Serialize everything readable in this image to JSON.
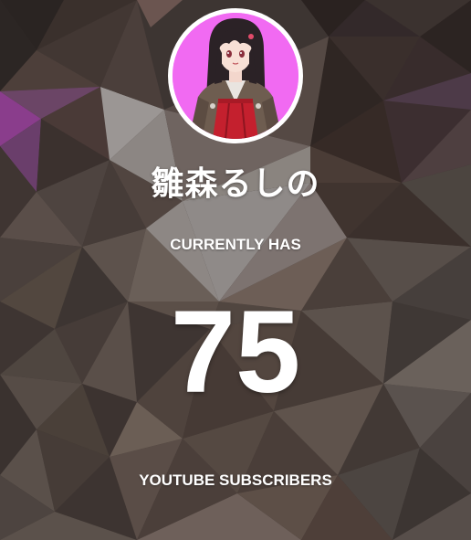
{
  "widget": {
    "channel_name": "雛森るしの",
    "pre_label": "CURRENTLY HAS",
    "subscriber_count": "75",
    "post_label": "YOUTUBE SUBSCRIBERS"
  },
  "avatar": {
    "icon": "vtuber-avatar",
    "background_color": "#f16af2",
    "ring_color": "#ffffff"
  },
  "colors": {
    "text": "#ffffff",
    "background_base": "#3d3532"
  }
}
